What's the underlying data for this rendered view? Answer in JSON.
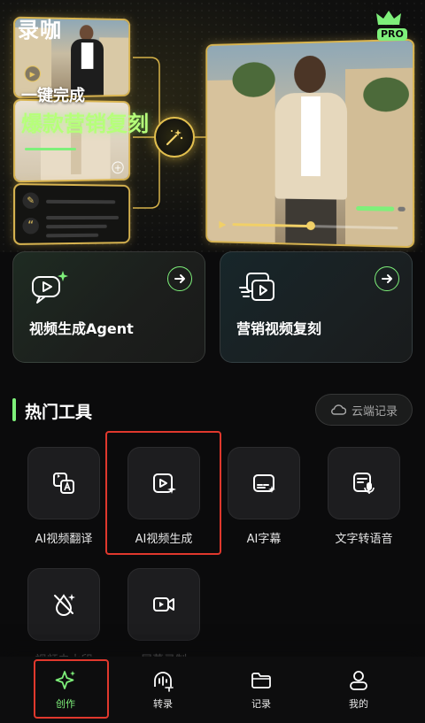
{
  "app": {
    "title": "录咖",
    "badge": "PRO"
  },
  "hero": {
    "tagline_line1": "一键完成",
    "tagline_line2": "爆款营销复刻"
  },
  "features": [
    {
      "label": "视频生成Agent",
      "icon": "video-agent-icon"
    },
    {
      "label": "营销视频复刻",
      "icon": "video-copy-icon"
    }
  ],
  "section": {
    "title": "热门工具",
    "cloud_button": "云端记录",
    "cloud_icon": "cloud-icon"
  },
  "tools": [
    {
      "label": "AI视频翻译",
      "icon": "translate-icon"
    },
    {
      "label": "AI视频生成",
      "icon": "video-generate-icon"
    },
    {
      "label": "AI字幕",
      "icon": "subtitle-icon"
    },
    {
      "label": "文字转语音",
      "icon": "text-to-speech-icon"
    },
    {
      "label": "视频去水印",
      "icon": "remove-watermark-icon"
    },
    {
      "label": "屏幕录制",
      "icon": "screen-record-icon"
    }
  ],
  "nav": {
    "active": "创作",
    "items": [
      {
        "label": "创作",
        "icon": "sparkle-icon"
      },
      {
        "label": "转录",
        "icon": "transcribe-icon"
      },
      {
        "label": "记录",
        "icon": "folder-icon"
      },
      {
        "label": "我的",
        "icon": "user-icon"
      }
    ]
  },
  "colors": {
    "accent": "#7ef07a",
    "gold": "#e2bf4e",
    "highlight": "#e0382d",
    "background": "#0b0b0c"
  }
}
